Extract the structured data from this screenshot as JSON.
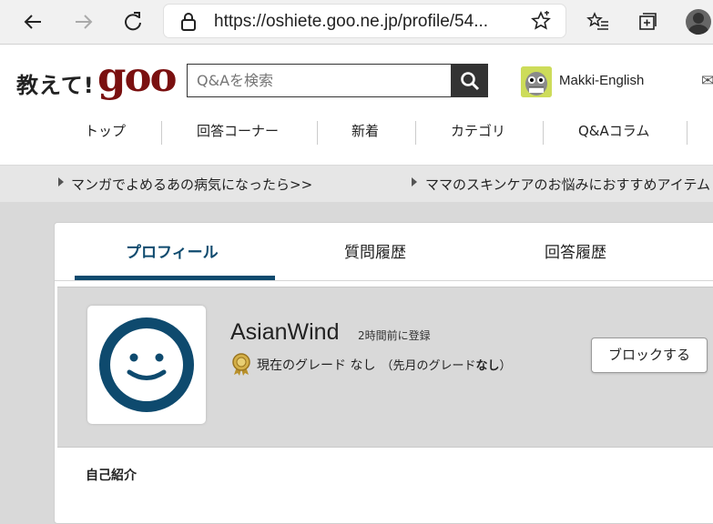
{
  "browser": {
    "url": "https://oshiete.goo.ne.jp/profile/54..."
  },
  "header": {
    "logo_kanji": "教えて!",
    "logo_goo": "goo",
    "search_placeholder": "Q&Aを検索",
    "user_name": "Makki-English"
  },
  "nav": {
    "items": [
      "トップ",
      "回答コーナー",
      "新着",
      "カテゴリ",
      "Q&Aコラム"
    ]
  },
  "promo": {
    "links": [
      "マンガでよめるあの病気になったら>>",
      "ママのスキンケアのお悩みにおすすめアイテム"
    ]
  },
  "profile": {
    "tabs": [
      "プロフィール",
      "質問履歴",
      "回答履歴"
    ],
    "name": "AsianWind",
    "registered": "2時間前に登録",
    "grade_current_label": "現在のグレード なし",
    "grade_prev_prefix": "（先月のグレード",
    "grade_prev_value": "なし",
    "grade_prev_suffix": "）",
    "block_button": "ブロックする",
    "intro_heading": "自己紹介"
  },
  "colors": {
    "accent": "#0e4a6e",
    "logo": "#7a1010"
  }
}
